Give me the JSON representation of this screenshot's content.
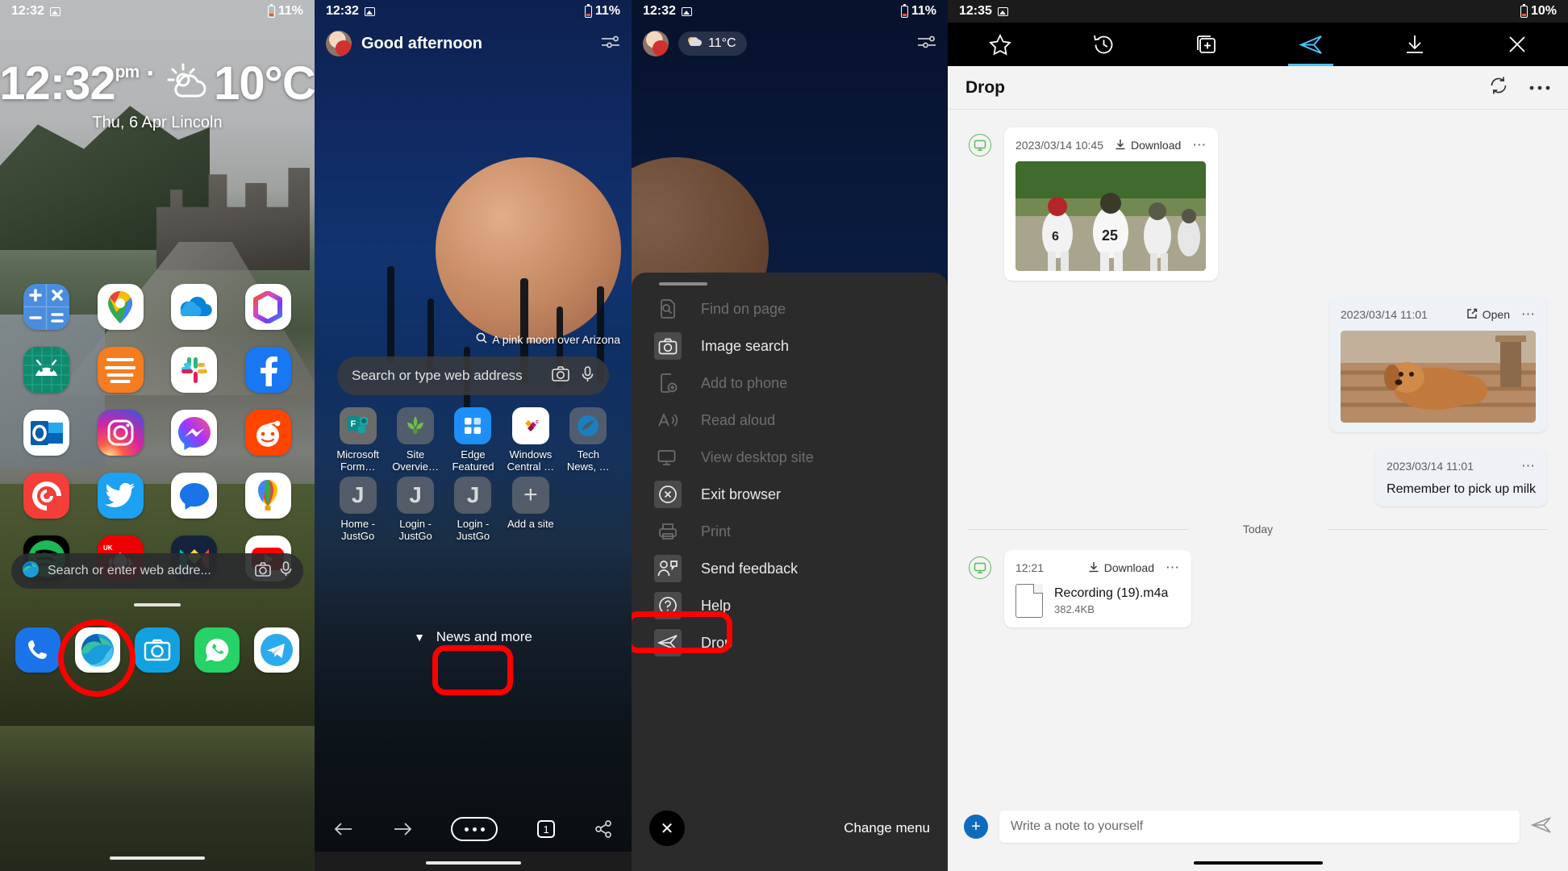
{
  "panel1": {
    "status": {
      "time": "12:32",
      "battery": "11%"
    },
    "lockscreen": {
      "time": "12:32",
      "meridiem": "pm",
      "separator": "·",
      "temperature": "10°C",
      "date": "Thu, 6 Apr",
      "location": "Lincoln"
    },
    "apps": [
      {
        "name": "Calculator",
        "icon": "calculator-icon"
      },
      {
        "name": "Google Maps",
        "icon": "maps-icon"
      },
      {
        "name": "OneDrive",
        "icon": "onedrive-icon"
      },
      {
        "name": "Microsoft 365",
        "icon": "microsoft365-icon"
      },
      {
        "name": "Android",
        "icon": "android-icon"
      },
      {
        "name": "Pocket Casts Files",
        "icon": "orange-stack-icon"
      },
      {
        "name": "Slack",
        "icon": "slack-icon"
      },
      {
        "name": "Facebook",
        "icon": "facebook-icon"
      },
      {
        "name": "Outlook",
        "icon": "outlook-icon"
      },
      {
        "name": "Instagram",
        "icon": "instagram-icon"
      },
      {
        "name": "Messenger",
        "icon": "messenger-icon"
      },
      {
        "name": "Reddit",
        "icon": "reddit-icon"
      },
      {
        "name": "Pocket Casts",
        "icon": "pocketcasts-icon"
      },
      {
        "name": "Twitter",
        "icon": "twitter-icon"
      },
      {
        "name": "Messages",
        "icon": "messages-icon"
      },
      {
        "name": "Google Earth",
        "icon": "balloon-icon"
      },
      {
        "name": "Spotify",
        "icon": "spotify-icon"
      },
      {
        "name": "Santander UK",
        "icon": "santander-icon"
      },
      {
        "name": "Monzo",
        "icon": "monzo-icon"
      },
      {
        "name": "YouTube",
        "icon": "youtube-icon"
      }
    ],
    "searchbar": {
      "placeholder": "Search or enter web addre...",
      "camera_icon": "camera-icon",
      "mic_icon": "microphone-icon"
    },
    "dock": [
      {
        "name": "Phone",
        "icon": "phone-icon"
      },
      {
        "name": "Microsoft Edge",
        "icon": "edge-icon",
        "highlighted": true
      },
      {
        "name": "Camera",
        "icon": "camera-app-icon"
      },
      {
        "name": "WhatsApp",
        "icon": "whatsapp-icon"
      },
      {
        "name": "Telegram",
        "icon": "telegram-icon"
      }
    ]
  },
  "panel2": {
    "status": {
      "time": "12:32",
      "battery": "11%"
    },
    "greeting": "Good afternoon",
    "settings_icon": "sliders-icon",
    "image_caption": "A pink moon over Arizona",
    "searchbar": {
      "placeholder": "Search or type web address",
      "camera_icon": "camera-icon",
      "mic_icon": "microphone-icon"
    },
    "tiles": [
      {
        "label": "Microsoft Form…",
        "glyph": "F"
      },
      {
        "label": "Site Overvie…",
        "glyph": "❦"
      },
      {
        "label": "Edge Featured",
        "glyph": "▦"
      },
      {
        "label": "Windows Central …",
        "glyph": "❖"
      },
      {
        "label": "Tech News, …",
        "glyph": "N"
      },
      {
        "label": "Home - JustGo",
        "glyph": "J"
      },
      {
        "label": "Login - JustGo",
        "glyph": "J"
      },
      {
        "label": "Login - JustGo",
        "glyph": "J"
      },
      {
        "label": "Add a site",
        "glyph": "+"
      }
    ],
    "news_and_more": "News and more",
    "bottom_bar": {
      "back": "back-arrow-icon",
      "forward": "forward-arrow-icon",
      "menu": "ellipsis-menu-button",
      "tab_count": "1",
      "share": "share-icon"
    }
  },
  "panel3": {
    "status": {
      "time": "12:32",
      "battery": "11%"
    },
    "weather_pill": "11°C",
    "settings_icon": "sliders-icon",
    "menu_items": [
      {
        "label": "Find on page",
        "icon": "find-on-page-icon",
        "enabled": false,
        "active": false
      },
      {
        "label": "Image search",
        "icon": "camera-icon",
        "enabled": true,
        "active": true
      },
      {
        "label": "Add to phone",
        "icon": "add-to-phone-icon",
        "enabled": false,
        "active": false
      },
      {
        "label": "Read aloud",
        "icon": "read-aloud-icon",
        "enabled": false,
        "active": false
      },
      {
        "label": "View desktop site",
        "icon": "desktop-site-icon",
        "enabled": false,
        "active": false
      },
      {
        "label": "Exit browser",
        "icon": "exit-browser-icon",
        "enabled": true,
        "active": true
      },
      {
        "label": "Print",
        "icon": "print-icon",
        "enabled": false,
        "active": false
      },
      {
        "label": "Send feedback",
        "icon": "feedback-icon",
        "enabled": true,
        "active": true
      },
      {
        "label": "Help",
        "icon": "help-icon",
        "enabled": true,
        "active": true
      },
      {
        "label": "Drop",
        "icon": "drop-send-icon",
        "enabled": true,
        "active": true,
        "highlighted": true
      }
    ],
    "close_button": "✕",
    "change_menu": "Change menu"
  },
  "panel4": {
    "status": {
      "time": "12:35",
      "battery": "10%"
    },
    "toolbar": [
      {
        "name": "favorites-tab",
        "icon": "star-icon",
        "selected": false
      },
      {
        "name": "history-tab",
        "icon": "history-icon",
        "selected": false
      },
      {
        "name": "collections-tab",
        "icon": "collections-icon",
        "selected": false
      },
      {
        "name": "drop-tab",
        "icon": "send-icon",
        "selected": true
      },
      {
        "name": "downloads-tab",
        "icon": "download-icon",
        "selected": false
      },
      {
        "name": "close-tab",
        "icon": "close-icon",
        "selected": false
      }
    ],
    "title": "Drop",
    "header_actions": [
      {
        "name": "sync-button",
        "icon": "sync-icon"
      },
      {
        "name": "more-options-button",
        "icon": "more-horizontal-icon"
      }
    ],
    "messages": [
      {
        "type": "image",
        "timestamp": "2023/03/14 10:45",
        "action": "Download",
        "action_icon": "download-icon",
        "more_icon": "more-horizontal-icon",
        "device_icon": "desktop-icon",
        "align": "left",
        "media": "football-photo"
      },
      {
        "type": "image",
        "timestamp": "2023/03/14 11:01",
        "action": "Open",
        "action_icon": "open-external-icon",
        "more_icon": "more-horizontal-icon",
        "align": "right",
        "media": "dog-photo"
      },
      {
        "type": "note",
        "timestamp": "2023/03/14 11:01",
        "more_icon": "more-horizontal-icon",
        "align": "right",
        "text": "Remember to pick up milk"
      }
    ],
    "day_divider": "Today",
    "file_message": {
      "timestamp": "12:21",
      "action": "Download",
      "action_icon": "download-icon",
      "more_icon": "more-horizontal-icon",
      "device_icon": "desktop-icon",
      "file_name": "Recording (19).m4a",
      "file_size": "382.4KB"
    },
    "compose": {
      "add_icon": "plus-icon",
      "placeholder": "Write a note to yourself",
      "send_icon": "send-icon"
    }
  },
  "colors": {
    "highlight": "#ff0000",
    "edge_accent": "#4cc2ff",
    "drop_blue": "#0f6cbd",
    "device_green": "#5eb85e"
  }
}
